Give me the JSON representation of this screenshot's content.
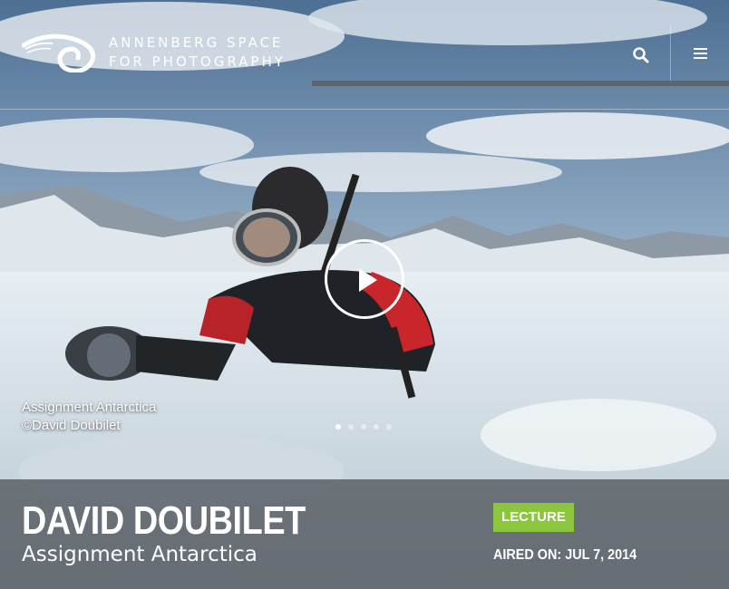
{
  "header": {
    "logo_line1": "ANNENBERG SPACE",
    "logo_line2": "FOR PHOTOGRAPHY",
    "search_icon": "search-icon",
    "menu_icon": "hamburger-menu-icon"
  },
  "slide": {
    "caption_title": "Assignment Antarctica",
    "caption_credit": "©David Doubilet",
    "play_icon": "play-icon",
    "dot_count": 5,
    "active_dot": 1
  },
  "event": {
    "title": "DAVID DOUBILET",
    "subtitle": "Assignment Antarctica",
    "badge": "LECTURE",
    "aired": "AIRED ON: JUL 7, 2014"
  },
  "colors": {
    "badge": "#8cc63f",
    "info_bar": "#464b50"
  }
}
